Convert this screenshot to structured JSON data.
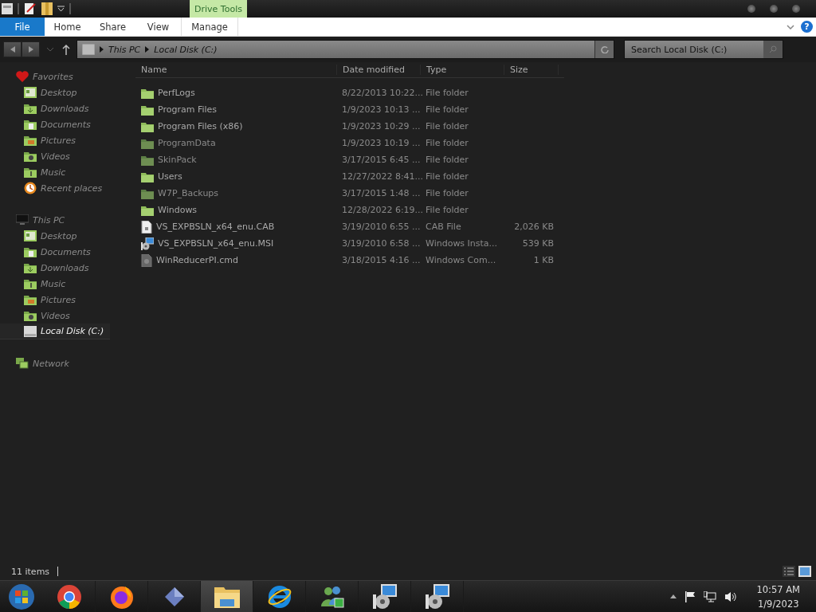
{
  "title_bar": {
    "context_tab": "Drive Tools"
  },
  "ribbon": {
    "tabs": [
      {
        "label": "File",
        "kind": "file",
        "selected": false
      },
      {
        "label": "Home",
        "kind": "tab",
        "selected": false
      },
      {
        "label": "Share",
        "kind": "tab",
        "selected": false
      },
      {
        "label": "View",
        "kind": "tab",
        "selected": false
      },
      {
        "label": "Manage",
        "kind": "context",
        "selected": false
      }
    ],
    "help": "?"
  },
  "address_bar": {
    "breadcrumbs": [
      "This PC",
      "Local Disk (C:)"
    ]
  },
  "search": {
    "placeholder": "Search Local Disk (C:)"
  },
  "sidebar": {
    "groups": [
      {
        "label": "Favorites",
        "kind": "favorites",
        "children": [
          {
            "label": "Desktop",
            "kind": "desktop",
            "selected": false
          },
          {
            "label": "Downloads",
            "kind": "downloads",
            "selected": false
          },
          {
            "label": "Documents",
            "kind": "documents",
            "selected": false
          },
          {
            "label": "Pictures",
            "kind": "pictures",
            "selected": false
          },
          {
            "label": "Videos",
            "kind": "videos",
            "selected": false
          },
          {
            "label": "Music",
            "kind": "music",
            "selected": false
          },
          {
            "label": "Recent places",
            "kind": "recent",
            "selected": false
          }
        ]
      },
      {
        "label": "This PC",
        "kind": "pc",
        "children": [
          {
            "label": "Desktop",
            "kind": "desktop",
            "selected": false
          },
          {
            "label": "Documents",
            "kind": "documents",
            "selected": false
          },
          {
            "label": "Downloads",
            "kind": "downloads",
            "selected": false
          },
          {
            "label": "Music",
            "kind": "music",
            "selected": false
          },
          {
            "label": "Pictures",
            "kind": "pictures",
            "selected": false
          },
          {
            "label": "Videos",
            "kind": "videos",
            "selected": false
          },
          {
            "label": "Local Disk (C:)",
            "kind": "disk",
            "selected": true
          }
        ]
      },
      {
        "label": "Network",
        "kind": "network"
      }
    ]
  },
  "table": {
    "columns": [
      "Name",
      "Date modified",
      "Type",
      "Size"
    ],
    "rows": [
      {
        "name": "PerfLogs",
        "date": "8/22/2013 10:22...",
        "type": "File folder",
        "kind": "folder",
        "hidden": false
      },
      {
        "name": "Program Files",
        "date": "1/9/2023 10:13 ...",
        "type": "File folder",
        "kind": "folder",
        "hidden": false
      },
      {
        "name": "Program Files (x86)",
        "date": "1/9/2023 10:29 ...",
        "type": "File folder",
        "kind": "folder",
        "hidden": false
      },
      {
        "name": "ProgramData",
        "date": "1/9/2023 10:19 ...",
        "type": "File folder",
        "kind": "folder",
        "hidden": true
      },
      {
        "name": "SkinPack",
        "date": "3/17/2015 6:45 ...",
        "type": "File folder",
        "kind": "folder",
        "hidden": true
      },
      {
        "name": "Users",
        "date": "12/27/2022 8:41...",
        "type": "File folder",
        "kind": "folder",
        "hidden": false
      },
      {
        "name": "W7P_Backups",
        "date": "3/17/2015 1:48 ...",
        "type": "File folder",
        "kind": "folder",
        "hidden": true
      },
      {
        "name": "Windows",
        "date": "12/28/2022 6:19...",
        "type": "File folder",
        "kind": "folder",
        "hidden": false
      },
      {
        "name": "VS_EXPBSLN_x64_enu.CAB",
        "date": "3/19/2010 6:55 ...",
        "type": "CAB File",
        "size": "2,026 KB",
        "kind": "document",
        "hidden": false
      },
      {
        "name": "VS_EXPBSLN_x64_enu.MSI",
        "date": "3/19/2010 6:58 ...",
        "type": "Windows Insta...",
        "size": "539 KB",
        "kind": "installer",
        "hidden": false
      },
      {
        "name": "WinReducerPI.cmd",
        "date": "3/18/2015 4:16 ...",
        "type": "Windows Com...",
        "size": "1 KB",
        "kind": "script",
        "hidden": false
      }
    ]
  },
  "status_bar": {
    "count": "11 items"
  },
  "taskbar": {
    "apps": [
      {
        "kind": "chrome",
        "active": false
      },
      {
        "kind": "firefox",
        "active": false
      },
      {
        "kind": "diamond",
        "active": false
      },
      {
        "kind": "explorer",
        "active": true
      },
      {
        "kind": "ie",
        "active": false
      },
      {
        "kind": "messenger",
        "active": false
      },
      {
        "kind": "installer",
        "active": false
      },
      {
        "kind": "installer",
        "active": false
      }
    ],
    "time": "10:57 AM",
    "date": "1/9/2023"
  }
}
